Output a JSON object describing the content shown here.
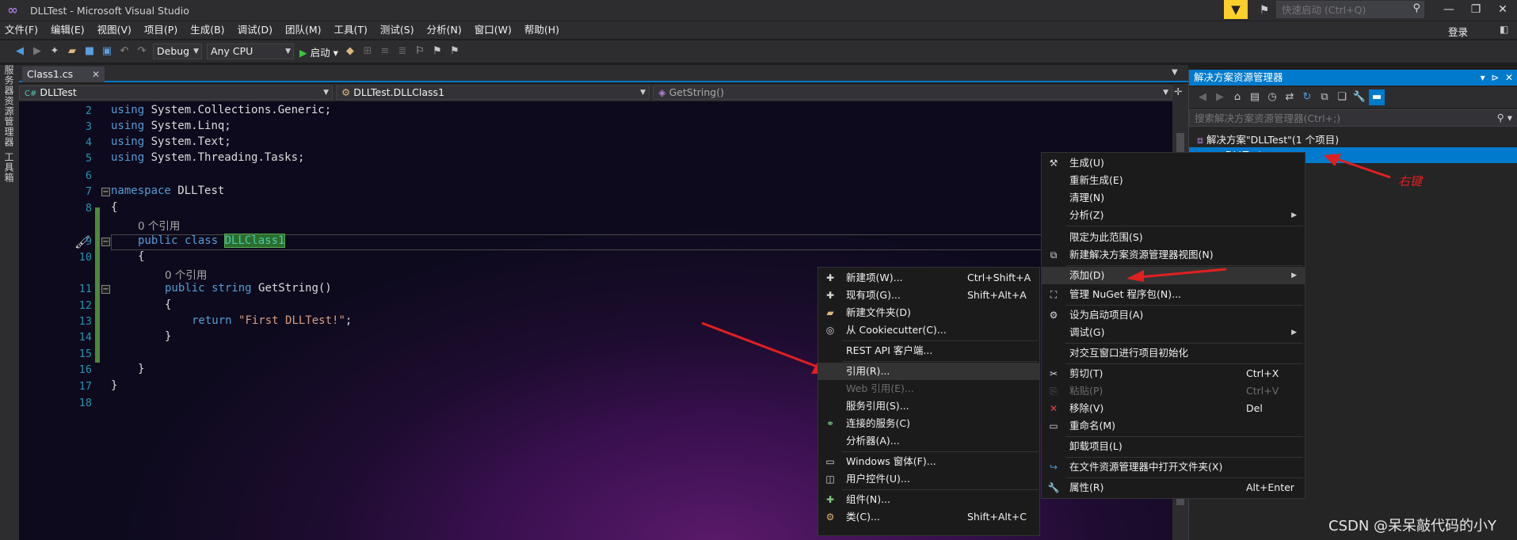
{
  "window": {
    "title": "DLLTest - Microsoft Visual Studio",
    "login": "登录"
  },
  "quick_launch": {
    "placeholder": "快速启动 (Ctrl+Q)"
  },
  "menubar": [
    "文件(F)",
    "编辑(E)",
    "视图(V)",
    "项目(P)",
    "生成(B)",
    "调试(D)",
    "团队(M)",
    "工具(T)",
    "测试(S)",
    "分析(N)",
    "窗口(W)",
    "帮助(H)"
  ],
  "toolbar": {
    "configuration": "Debug",
    "platform": "Any CPU",
    "start_label": "启动"
  },
  "left_strip": {
    "server_explorer": "服务器资源管理器",
    "toolbox": "工具箱"
  },
  "tabs": [
    {
      "label": "Class1.cs"
    }
  ],
  "navbar": {
    "project": "DLLTest",
    "type": "DLLTest.DLLClass1",
    "member": "GetString()"
  },
  "editor": {
    "line_numbers": [
      "2",
      "3",
      "4",
      "5",
      "6",
      "7",
      "8",
      "9",
      "10",
      "11",
      "12",
      "13",
      "14",
      "15",
      "16",
      "17",
      "18"
    ],
    "using_keyword": "using",
    "namespaces": [
      "System.Collections.Generic;",
      "System.Linq;",
      "System.Text;",
      "System.Threading.Tasks;"
    ],
    "ns_keyword": "namespace",
    "ns_name": "DLLTest",
    "brace_open": "{",
    "brace_close": "}",
    "codelens": "0 个引用",
    "class_kw": "public class",
    "class_name": "DLLClass1",
    "method_kw": "public string",
    "method_name": "GetString()",
    "return_kw": "return",
    "string_literal": "\"First DLLTest!\"",
    "semicolon": ";"
  },
  "solution_explorer": {
    "title": "解决方案资源管理器",
    "search_placeholder": "搜索解决方案资源管理器(Ctrl+;)",
    "solution_label": "解决方案\"DLLTest\"(1 个项目)",
    "project_label": "DLLTest"
  },
  "context_menu": [
    {
      "label": "生成(U)",
      "icon": "build-icon"
    },
    {
      "label": "重新生成(E)"
    },
    {
      "label": "清理(N)"
    },
    {
      "label": "分析(Z)",
      "submenu": true
    },
    {
      "label": "限定为此范围(S)"
    },
    {
      "label": "新建解决方案资源管理器视图(N)",
      "icon": "new-view-icon"
    },
    {
      "label": "添加(D)",
      "submenu": true,
      "highlighted": true
    },
    {
      "label": "管理 NuGet 程序包(N)...",
      "icon": "nuget-icon"
    },
    {
      "label": "设为启动项目(A)",
      "icon": "gear-icon"
    },
    {
      "label": "调试(G)",
      "submenu": true
    },
    {
      "label": "对交互窗口进行项目初始化"
    },
    {
      "label": "剪切(T)",
      "shortcut": "Ctrl+X",
      "icon": "cut-icon"
    },
    {
      "label": "粘贴(P)",
      "shortcut": "Ctrl+V",
      "disabled": true,
      "icon": "paste-icon"
    },
    {
      "label": "移除(V)",
      "shortcut": "Del",
      "icon": "remove-icon"
    },
    {
      "label": "重命名(M)",
      "icon": "rename-icon"
    },
    {
      "label": "卸载项目(L)"
    },
    {
      "label": "在文件资源管理器中打开文件夹(X)",
      "icon": "open-folder-icon"
    },
    {
      "label": "属性(R)",
      "shortcut": "Alt+Enter",
      "icon": "wrench-icon"
    }
  ],
  "add_submenu": [
    {
      "label": "新建项(W)...",
      "shortcut": "Ctrl+Shift+A",
      "icon": "new-item-icon"
    },
    {
      "label": "现有项(G)...",
      "shortcut": "Shift+Alt+A",
      "icon": "existing-item-icon"
    },
    {
      "label": "新建文件夹(D)",
      "icon": "new-folder-icon"
    },
    {
      "label": "从 Cookiecutter(C)...",
      "icon": "cookiecutter-icon"
    },
    {
      "label": "REST API 客户端..."
    },
    {
      "label": "引用(R)...",
      "highlighted": true
    },
    {
      "label": "Web 引用(E)...",
      "disabled": true
    },
    {
      "label": "服务引用(S)..."
    },
    {
      "label": "连接的服务(C)",
      "icon": "connected-service-icon"
    },
    {
      "label": "分析器(A)..."
    },
    {
      "label": "Windows 窗体(F)...",
      "icon": "winform-icon"
    },
    {
      "label": "用户控件(U)...",
      "icon": "user-control-icon"
    },
    {
      "label": "组件(N)...",
      "icon": "component-icon"
    },
    {
      "label": "类(C)...",
      "shortcut": "Shift+Alt+C",
      "icon": "class-icon"
    }
  ],
  "annotation": {
    "text": "右键",
    "color": "#e02020"
  },
  "watermark": "CSDN @呆呆敲代码的小Y",
  "colors": {
    "accent": "#007acc",
    "chrome": "#2d2d30",
    "keyword": "#569cd6",
    "string": "#d69d85",
    "type": "#4ec9b0",
    "line_number": "#2b91af"
  }
}
